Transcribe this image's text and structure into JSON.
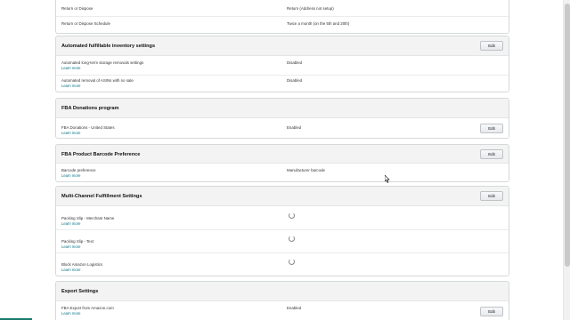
{
  "top_rows": [
    {
      "label": "Return or Dispose",
      "value": "Return (Address not setup)"
    },
    {
      "label": "Return or Dispose Schedule",
      "value": "Twice a month (on the 5th and 20th)"
    }
  ],
  "learn_more": "Learn more",
  "edit_label": "Edit",
  "sections": {
    "inventory": {
      "title": "Automated fulfillable inventory settings",
      "rows": [
        {
          "label": "Automated long-term storage removals settings",
          "value": "Disabled"
        },
        {
          "label": "Automated removal of ASINs with no sale",
          "value": "Disabled"
        }
      ]
    },
    "donations": {
      "title": "FBA Donations program",
      "rows": [
        {
          "label": "FBA Donations - United States",
          "value": "Enabled"
        }
      ]
    },
    "barcode": {
      "title": "FBA Product Barcode Preference",
      "rows": [
        {
          "label": "Barcode preference",
          "value": "Manufacturer barcode"
        }
      ]
    },
    "mcf": {
      "title": "Multi-Channel Fulfillment Settings",
      "rows": [
        {
          "label": "Packing Slip - Merchant Name",
          "value_state": "loading"
        },
        {
          "label": "Packing Slip - Text",
          "value_state": "loading"
        },
        {
          "label": "Block Amazon Logistics",
          "value_state": "loading"
        }
      ]
    },
    "export": {
      "title": "Export Settings",
      "rows": [
        {
          "label": "FBA Export from Amazon.com",
          "value": "Enabled"
        }
      ]
    }
  },
  "colors": {
    "link": "#007185",
    "header_bg": "#f3f3f3",
    "border": "#d5d9d9"
  }
}
